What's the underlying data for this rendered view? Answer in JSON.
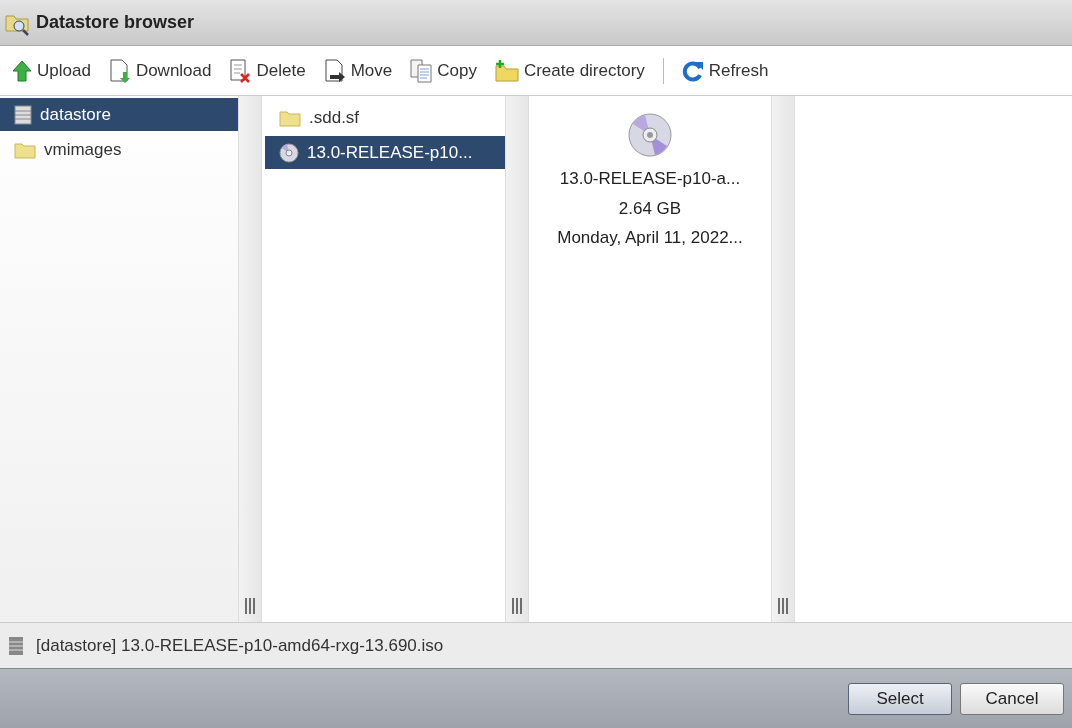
{
  "window": {
    "title": "Datastore browser"
  },
  "toolbar": [
    {
      "label": "Upload",
      "kind": "upload"
    },
    {
      "label": "Download",
      "kind": "download"
    },
    {
      "label": "Delete",
      "kind": "delete"
    },
    {
      "label": "Move",
      "kind": "move"
    },
    {
      "label": "Copy",
      "kind": "copy"
    },
    {
      "label": "Create directory",
      "kind": "mkdir"
    },
    {
      "label": "Refresh",
      "kind": "refresh",
      "separator_before": true
    }
  ],
  "columns": [
    {
      "items": [
        {
          "label": "datastore",
          "kind": "datastore",
          "selected": true
        },
        {
          "label": "vmimages",
          "kind": "folder",
          "selected": false
        }
      ]
    },
    {
      "items": [
        {
          "label": ".sdd.sf",
          "kind": "folder",
          "selected": false
        },
        {
          "label": "13.0-RELEASE-p10...",
          "kind": "disc",
          "selected": true
        }
      ]
    }
  ],
  "preview": {
    "name": "13.0-RELEASE-p10-a...",
    "size": "2.64 GB",
    "date": "Monday, April 11, 2022..."
  },
  "path_bar": {
    "text": "[datastore] 13.0-RELEASE-p10-amd64-rxg-13.690.iso"
  },
  "buttons": [
    {
      "label": "Select",
      "kind": "primary"
    },
    {
      "label": "Cancel",
      "kind": "secondary"
    }
  ]
}
